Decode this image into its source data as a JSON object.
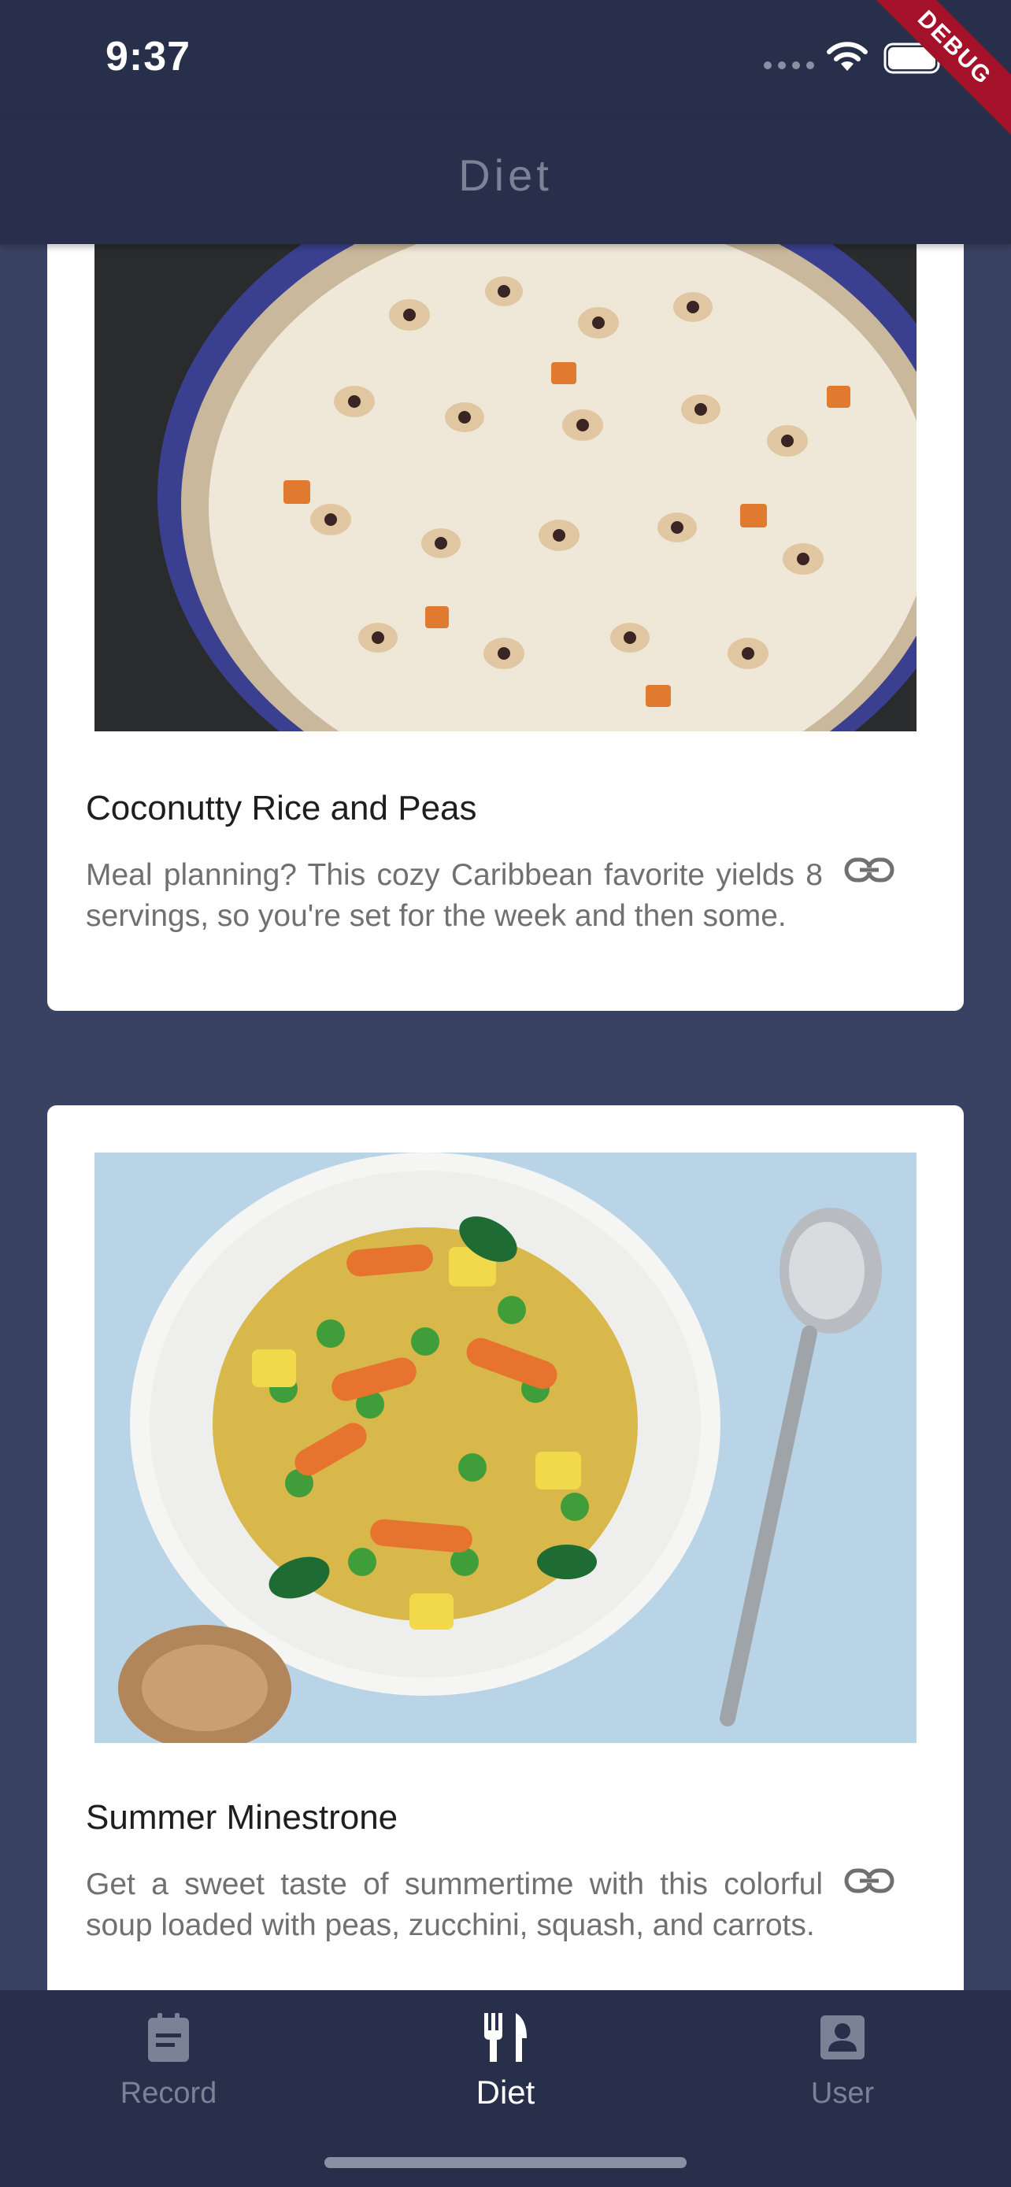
{
  "status_bar": {
    "time": "9:37"
  },
  "debug_banner": "DEBUG",
  "header": {
    "title": "Diet"
  },
  "cards": [
    {
      "title": "Coconutty Rice and Peas",
      "description": "Meal planning? This cozy Caribbean favorite yields 8 servings, so you're set for the week and then some.",
      "image_icon": "rice-and-peas-image",
      "link_icon": "link-icon"
    },
    {
      "title": "Summer Minestrone",
      "description": "Get a sweet taste of summertime with this colorful soup loaded with peas, zucchini, squash, and carrots.",
      "image_icon": "minestrone-image",
      "link_icon": "link-icon"
    }
  ],
  "bottom_nav": {
    "items": [
      {
        "label": "Record",
        "icon": "clipboard-icon",
        "active": false
      },
      {
        "label": "Diet",
        "icon": "fork-knife-icon",
        "active": true
      },
      {
        "label": "User",
        "icon": "person-icon",
        "active": false
      }
    ]
  },
  "colors": {
    "background": "#3a4263",
    "bar": "#272f4b",
    "inactive": "#7c8296",
    "active": "#ffffff",
    "debug": "#a4122a"
  }
}
